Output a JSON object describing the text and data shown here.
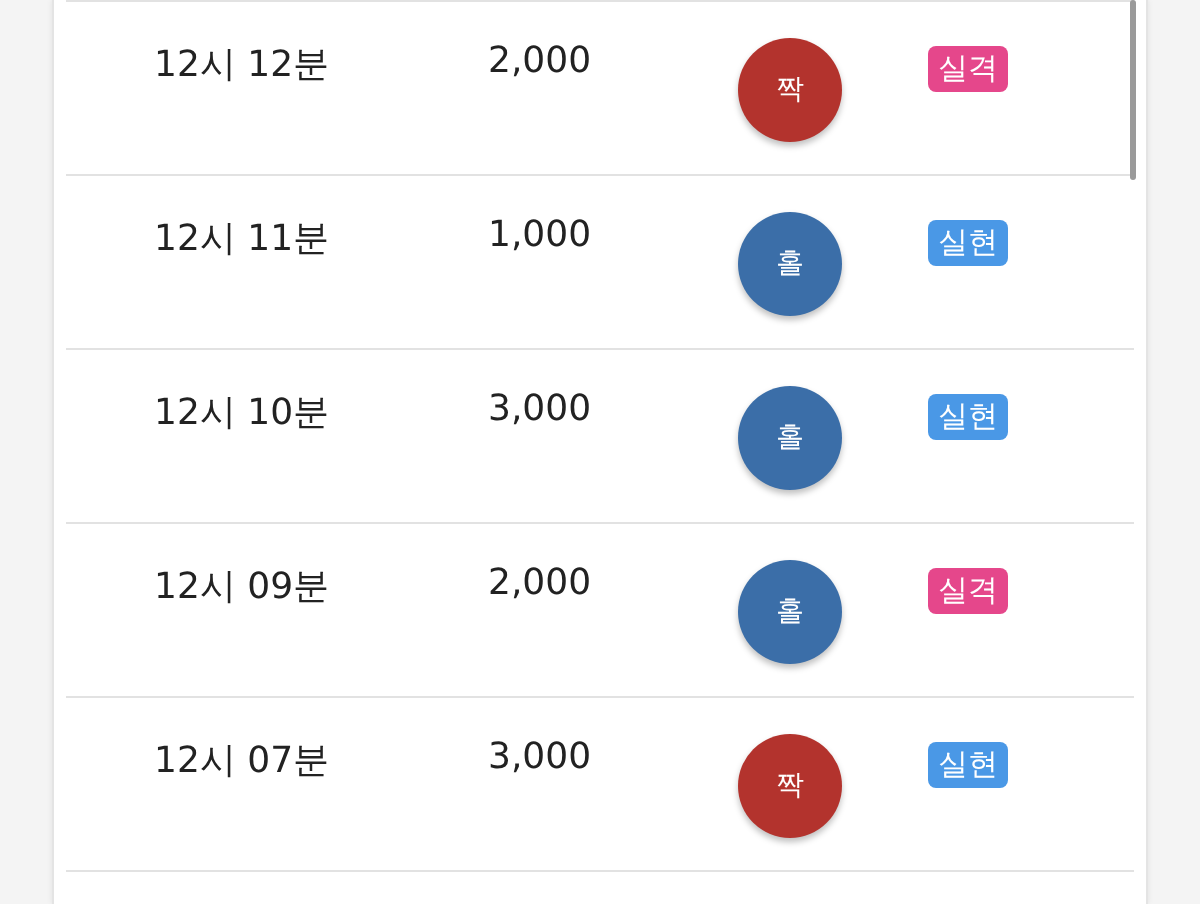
{
  "rows": [
    {
      "time": "12시 12분",
      "amount": "2,000",
      "ball": {
        "label": "짝",
        "color": "#b3332d"
      },
      "result": {
        "label": "실격",
        "color": "#e5478b"
      }
    },
    {
      "time": "12시 11분",
      "amount": "1,000",
      "ball": {
        "label": "홀",
        "color": "#3b6ea8"
      },
      "result": {
        "label": "실현",
        "color": "#4a98e6"
      }
    },
    {
      "time": "12시 10분",
      "amount": "3,000",
      "ball": {
        "label": "홀",
        "color": "#3b6ea8"
      },
      "result": {
        "label": "실현",
        "color": "#4a98e6"
      }
    },
    {
      "time": "12시 09분",
      "amount": "2,000",
      "ball": {
        "label": "홀",
        "color": "#3b6ea8"
      },
      "result": {
        "label": "실격",
        "color": "#e5478b"
      }
    },
    {
      "time": "12시 07분",
      "amount": "3,000",
      "ball": {
        "label": "짝",
        "color": "#b3332d"
      },
      "result": {
        "label": "실현",
        "color": "#4a98e6"
      }
    }
  ]
}
